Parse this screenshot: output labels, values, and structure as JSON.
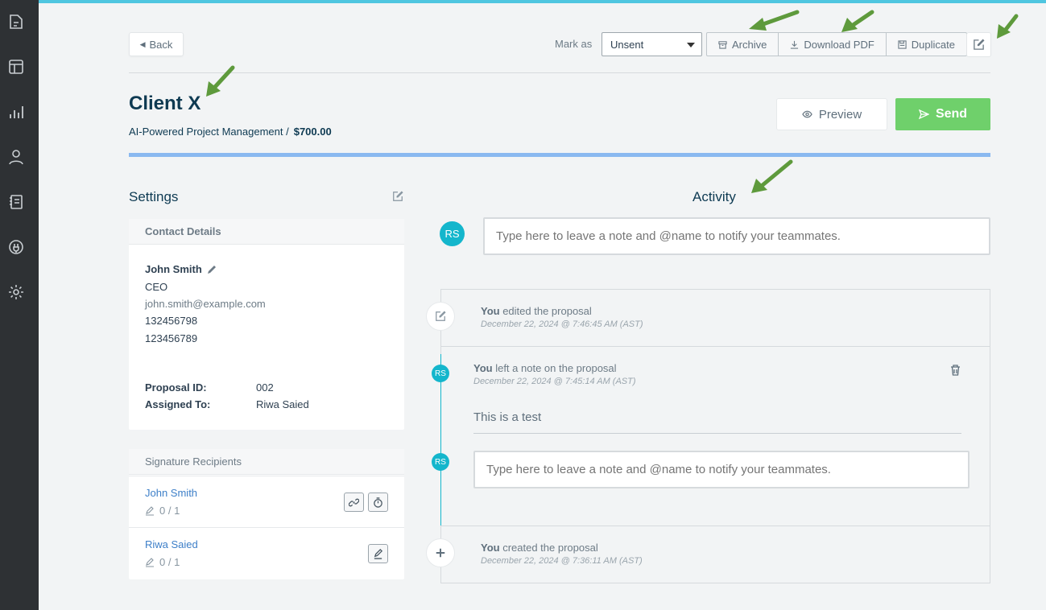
{
  "toolbar": {
    "back_label": "Back",
    "mark_as_label": "Mark as",
    "status_value": "Unsent",
    "archive_label": "Archive",
    "download_label": "Download PDF",
    "duplicate_label": "Duplicate"
  },
  "proposal": {
    "title": "Client X",
    "subtitle": "AI-Powered Project Management /",
    "amount": "$700.00",
    "preview_label": "Preview",
    "send_label": "Send"
  },
  "settings": {
    "title": "Settings",
    "contact": {
      "header": "Contact Details",
      "name": "John Smith",
      "role": "CEO",
      "email": "john.smith@example.com",
      "phone1": "132456798",
      "phone2": "123456789",
      "proposal_id_label": "Proposal ID:",
      "proposal_id": "002",
      "assigned_label": "Assigned To:",
      "assigned": "Riwa Saied"
    },
    "signatures": {
      "header": "Signature Recipients",
      "recipients": [
        {
          "name": "John Smith",
          "count": "0 / 1"
        },
        {
          "name": "Riwa Saied",
          "count": "0 / 1"
        }
      ]
    }
  },
  "activity": {
    "title": "Activity",
    "avatar_initials": "RS",
    "note_placeholder": "Type here to leave a note and @name to notify your teammates.",
    "events": [
      {
        "actor": "You",
        "action": " edited the proposal",
        "date": "December 22, 2024 @ 7:46:45 AM (AST)"
      },
      {
        "actor": "You",
        "action": " left a note on the proposal",
        "date": "December 22, 2024 @ 7:45:14 AM (AST)",
        "note": "This is a test"
      },
      {
        "actor": "You",
        "action": " created the proposal",
        "date": "December 22, 2024 @ 7:36:11 AM (AST)"
      }
    ]
  },
  "colors": {
    "accent": "#14b6cc",
    "send": "#6fd06b",
    "sidebar": "#2e3134",
    "annotation_arrow": "#5e9a3c"
  }
}
